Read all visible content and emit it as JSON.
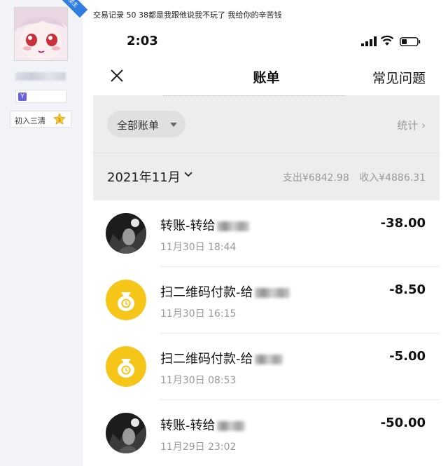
{
  "forum": {
    "owner_badge": "楼主",
    "group_icon": "Y",
    "rank_label": "初入三清",
    "rank_level": "1",
    "post_text": "交易记录 50 38都是我跟他说我不玩了 我给你的辛苦钱"
  },
  "status_bar": {
    "time": "2:03"
  },
  "nav": {
    "title": "账单",
    "faq": "常见问题"
  },
  "filter": {
    "label": "全部账单",
    "stats": "统计 ›"
  },
  "month": {
    "label": "2021年11月",
    "expense": "支出¥6842.98",
    "income": "收入¥4886.31"
  },
  "transactions": [
    {
      "name": "转账-转给",
      "time": "11月30日 18:44",
      "amount": "-38.00",
      "icon": "contact-photo-icon"
    },
    {
      "name": "扫二维码付款-给",
      "time": "11月30日 16:15",
      "amount": "-8.50",
      "icon": "money-bag-icon"
    },
    {
      "name": "扫二维码付款-给",
      "time": "11月30日 08:53",
      "amount": "-5.00",
      "icon": "money-bag-icon"
    },
    {
      "name": "转账-转给",
      "time": "11月29日 23:02",
      "amount": "-50.00",
      "icon": "contact-photo-icon"
    }
  ],
  "colors": {
    "accent_yellow": "#f5c518",
    "grey_header": "#ededed"
  }
}
